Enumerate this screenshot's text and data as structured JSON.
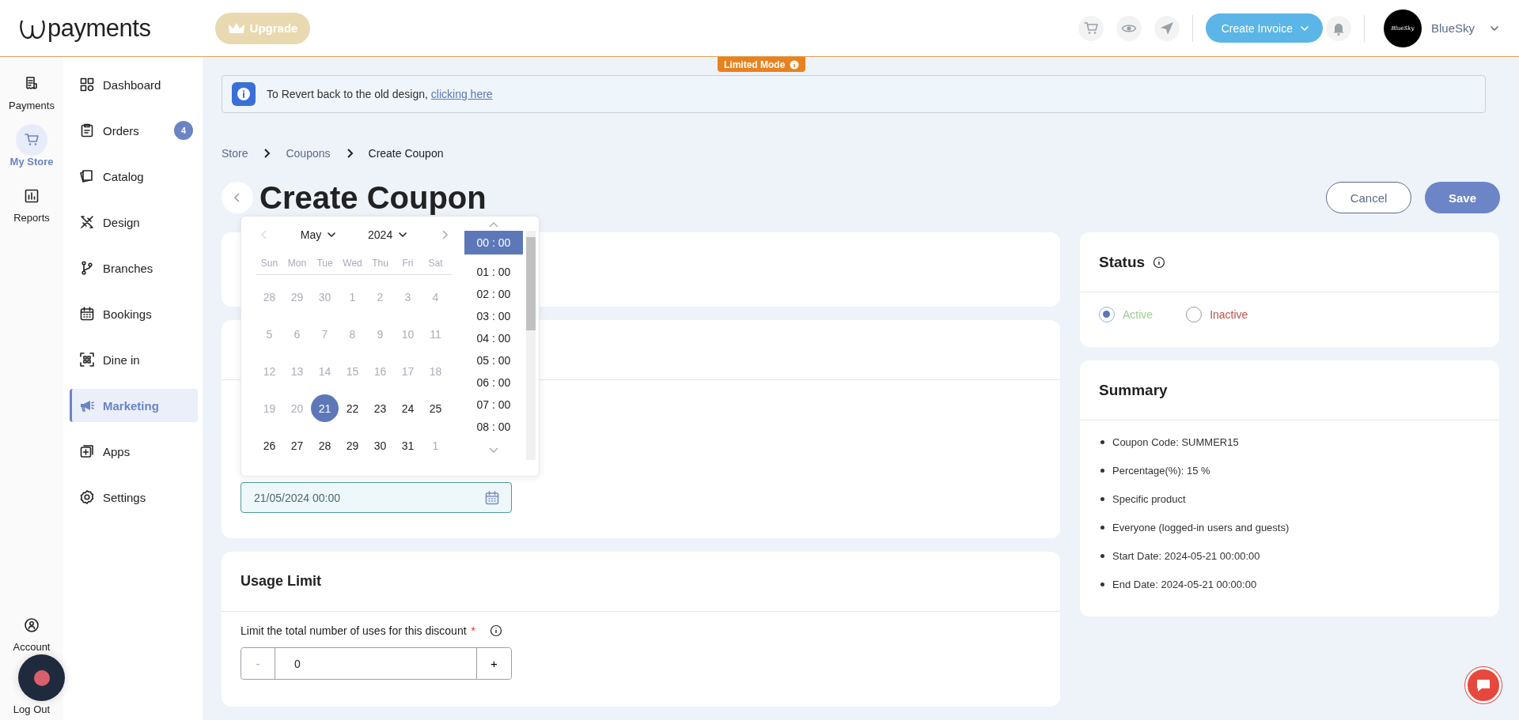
{
  "header": {
    "logo_text": "payments",
    "upgrade_button": "Upgrade",
    "create_invoice_button": "Create Invoice",
    "user": {
      "avatar_text": "BlueSky",
      "name": "BlueSky"
    }
  },
  "rail": {
    "items": [
      {
        "label": "Payments",
        "selected": false
      },
      {
        "label": "My Store",
        "selected": true
      },
      {
        "label": "Reports",
        "selected": false
      }
    ],
    "bottom_items": [
      {
        "label": "Account"
      },
      {
        "label": "Log Out"
      }
    ]
  },
  "nav": {
    "items": [
      {
        "label": "Dashboard",
        "selected": false
      },
      {
        "label": "Orders",
        "selected": false,
        "badge": "4"
      },
      {
        "label": "Catalog",
        "selected": false
      },
      {
        "label": "Design",
        "selected": false
      },
      {
        "label": "Branches",
        "selected": false
      },
      {
        "label": "Bookings",
        "selected": false
      },
      {
        "label": "Dine in",
        "selected": false
      },
      {
        "label": "Marketing",
        "selected": true
      },
      {
        "label": "Apps",
        "selected": false
      },
      {
        "label": "Settings",
        "selected": false
      }
    ]
  },
  "limited_mode_badge": "Limited Mode",
  "banner": {
    "text": "To Revert back to the old design,",
    "link": "clicking here"
  },
  "breadcrumb": [
    "Store",
    "Coupons",
    "Create Coupon"
  ],
  "page_title": "Create Coupon",
  "actions": {
    "cancel": "Cancel",
    "save": "Save"
  },
  "date_field": {
    "value": "21/05/2024 00:00"
  },
  "date_picker": {
    "month": "May",
    "year": "2024",
    "weekdays": [
      "Sun",
      "Mon",
      "Tue",
      "Wed",
      "Thu",
      "Fri",
      "Sat"
    ],
    "days": [
      {
        "label": "28",
        "disabled": true,
        "selected": false
      },
      {
        "label": "29",
        "disabled": true,
        "selected": false
      },
      {
        "label": "30",
        "disabled": true,
        "selected": false
      },
      {
        "label": "1",
        "disabled": true,
        "selected": false
      },
      {
        "label": "2",
        "disabled": true,
        "selected": false
      },
      {
        "label": "3",
        "disabled": true,
        "selected": false
      },
      {
        "label": "4",
        "disabled": true,
        "selected": false
      },
      {
        "label": "5",
        "disabled": true,
        "selected": false
      },
      {
        "label": "6",
        "disabled": true,
        "selected": false
      },
      {
        "label": "7",
        "disabled": true,
        "selected": false
      },
      {
        "label": "8",
        "disabled": true,
        "selected": false
      },
      {
        "label": "9",
        "disabled": true,
        "selected": false
      },
      {
        "label": "10",
        "disabled": true,
        "selected": false
      },
      {
        "label": "11",
        "disabled": true,
        "selected": false
      },
      {
        "label": "12",
        "disabled": true,
        "selected": false
      },
      {
        "label": "13",
        "disabled": true,
        "selected": false
      },
      {
        "label": "14",
        "disabled": true,
        "selected": false
      },
      {
        "label": "15",
        "disabled": true,
        "selected": false
      },
      {
        "label": "16",
        "disabled": true,
        "selected": false
      },
      {
        "label": "17",
        "disabled": true,
        "selected": false
      },
      {
        "label": "18",
        "disabled": true,
        "selected": false
      },
      {
        "label": "19",
        "disabled": true,
        "selected": false
      },
      {
        "label": "20",
        "disabled": true,
        "selected": false
      },
      {
        "label": "21",
        "disabled": false,
        "selected": true
      },
      {
        "label": "22",
        "disabled": false,
        "selected": false
      },
      {
        "label": "23",
        "disabled": false,
        "selected": false
      },
      {
        "label": "24",
        "disabled": false,
        "selected": false
      },
      {
        "label": "25",
        "disabled": false,
        "selected": false
      },
      {
        "label": "26",
        "disabled": false,
        "selected": false
      },
      {
        "label": "27",
        "disabled": false,
        "selected": false
      },
      {
        "label": "28",
        "disabled": false,
        "selected": false
      },
      {
        "label": "29",
        "disabled": false,
        "selected": false
      },
      {
        "label": "30",
        "disabled": false,
        "selected": false
      },
      {
        "label": "31",
        "disabled": false,
        "selected": false
      },
      {
        "label": "1",
        "disabled": true,
        "selected": false
      }
    ],
    "times": [
      {
        "label": "00 : 00",
        "selected": true
      },
      {
        "label": "01 : 00",
        "selected": false
      },
      {
        "label": "02 : 00",
        "selected": false
      },
      {
        "label": "03 : 00",
        "selected": false
      },
      {
        "label": "04 : 00",
        "selected": false
      },
      {
        "label": "05 : 00",
        "selected": false
      },
      {
        "label": "06 : 00",
        "selected": false
      },
      {
        "label": "07 : 00",
        "selected": false
      },
      {
        "label": "08 : 00",
        "selected": false
      }
    ]
  },
  "usage_limit": {
    "title": "Usage Limit",
    "label": "Limit the total number of uses for this discount",
    "required_mark": "*",
    "minus": "-",
    "value": "0",
    "plus": "+"
  },
  "status": {
    "title": "Status",
    "options": [
      {
        "label": "Active",
        "selected": true,
        "color": "#9ccf8e"
      },
      {
        "label": "Inactive",
        "selected": false,
        "color": "#c0524a"
      }
    ]
  },
  "summary": {
    "title": "Summary",
    "items": [
      "Coupon Code: SUMMER15",
      "Percentage(%): 15 %",
      "Specific product",
      "Everyone (logged-in users and guests)",
      "Start Date: 2024-05-21 00:00:00",
      "End Date: 2024-05-21 00:00:00"
    ]
  }
}
